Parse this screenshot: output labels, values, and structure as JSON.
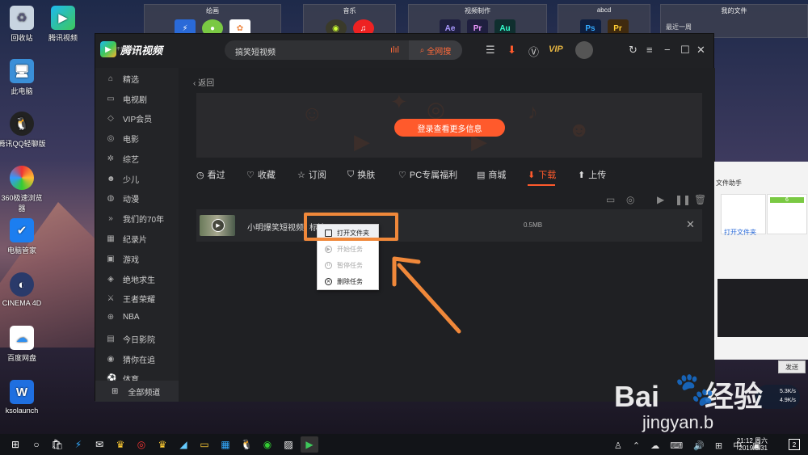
{
  "desktop": {
    "icons": [
      "回收站",
      "腾讯视频",
      "此电脑",
      "腾讯QQ轻聊版",
      "360极速浏览器",
      "电脑管家",
      "CINEMA 4D",
      "百度网盘",
      "ksolaunch"
    ]
  },
  "top_groups": [
    "绘画",
    "音乐",
    "视频制作",
    "abcd",
    "我的文件"
  ],
  "top_group_sub": "最近一周",
  "app": {
    "logo_text": "腾讯视频",
    "logo_sub": "不负好时光",
    "search_value": "搞笑短视频",
    "search_button": "全网搜",
    "vip": "VIP"
  },
  "sidebar": {
    "items": [
      "精选",
      "电视剧",
      "VIP会员",
      "电影",
      "综艺",
      "少儿",
      "动漫",
      "我们的70年",
      "纪录片",
      "游戏",
      "绝地求生",
      "王者荣耀",
      "NBA",
      "今日影院",
      "猜你在追",
      "体育"
    ],
    "all": "全部频道"
  },
  "content": {
    "back": "返回",
    "login_button": "登录查看更多信息",
    "tabs": [
      "看过",
      "收藏",
      "订阅",
      "换肤",
      "PC专属福利",
      "商城",
      "下载",
      "上传"
    ],
    "active_tab": 6,
    "row": {
      "title": "小明爆笑短视频!",
      "title_part2": "标清",
      "size": "0.5MB"
    }
  },
  "context_menu": [
    "打开文件夹",
    "开始任务",
    "暂停任务",
    "删除任务"
  ],
  "right_panel": {
    "title": "文件助手",
    "link": "打开文件夹",
    "send": "发送",
    "badge": "6"
  },
  "net": {
    "up": "5.3K/s",
    "down": "4.9K/s"
  },
  "watermark": {
    "main": "Bai",
    "suffix": "经验",
    "url": "jingyan.b"
  },
  "taskbar": {
    "time": "21:12 周六",
    "date": "2019/8/31",
    "badge": "2"
  },
  "colors": {
    "accent": "#ff5a2c",
    "highlight": "#f0883a"
  }
}
